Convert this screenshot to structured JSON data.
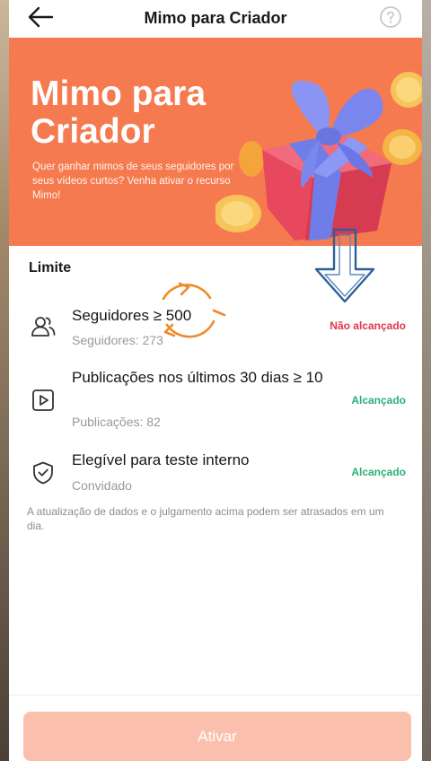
{
  "header": {
    "title": "Mimo para Criador",
    "back_icon": "arrow-left-icon",
    "help_icon": "question-circle-icon"
  },
  "banner": {
    "title_line1": "Mimo para",
    "title_line2": "Criador",
    "description": "Quer ganhar mimos de seus seguidores por seus vídeos curtos? Venha ativar o recurso Mimo!",
    "background": "#f57a4f"
  },
  "limits": {
    "section_title": "Limite",
    "items": [
      {
        "icon": "users-icon",
        "title": "Seguidores ≥ 500",
        "subtitle": "Seguidores: 273",
        "status": "Não alcançado"
      },
      {
        "icon": "video-play-icon",
        "title": "Publicações nos últimos 30 dias ≥ 10",
        "subtitle": "Publicações: 82",
        "status": "Alcançado"
      },
      {
        "icon": "shield-check-icon",
        "title": "Elegível para teste interno",
        "subtitle": "Convidado",
        "status": "Alcançado"
      }
    ],
    "note": "A atualização de dados e o julgamento acima podem ser atrasados em um dia."
  },
  "footer": {
    "activate_label": "Ativar"
  },
  "colors": {
    "accent": "#f57a4f",
    "not_reached": "#e1374b",
    "reached": "#2fae7a",
    "button_disabled": "#fbc0ad"
  }
}
